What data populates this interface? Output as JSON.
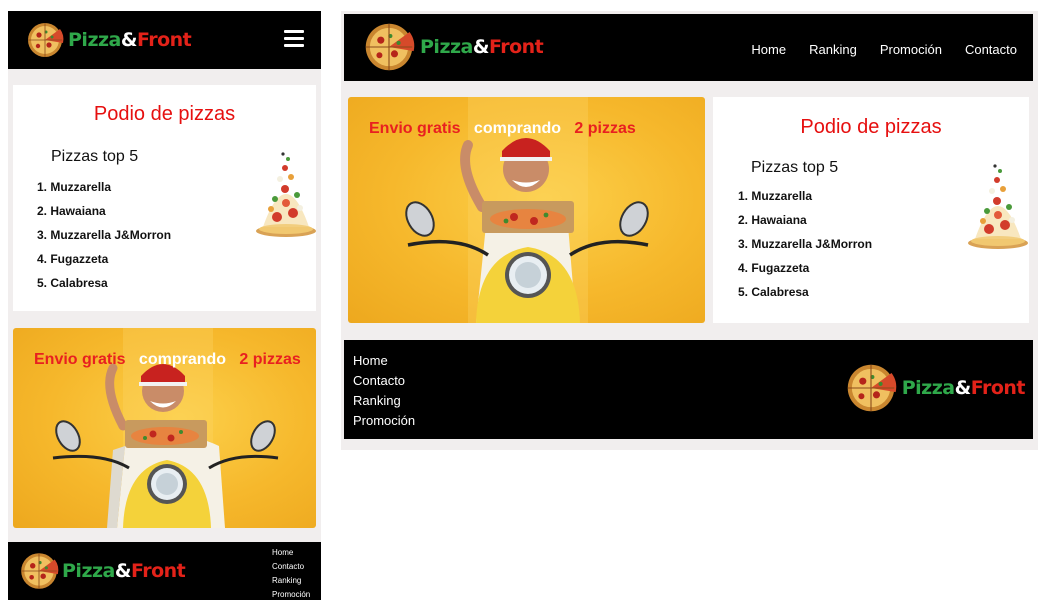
{
  "brand": {
    "part1": "Pizza",
    "amp": "&",
    "part2": "Front"
  },
  "nav": [
    "Home",
    "Ranking",
    "Promoción",
    "Contacto"
  ],
  "footer_links": [
    "Home",
    "Contacto",
    "Ranking",
    "Promoción"
  ],
  "podium": {
    "title": "Podio de pizzas",
    "subtitle": "Pizzas top 5",
    "items": [
      "Muzzarella",
      "Hawaiana",
      "Muzzarella J&Morron",
      "Fugazzeta",
      "Calabresa"
    ]
  },
  "promo": {
    "part1": "Envio gratis",
    "part2": "comprando",
    "part3": "2 pizzas"
  },
  "colors": {
    "header": "#000000",
    "green": "#2fa84a",
    "red": "#e32219",
    "promo_bg": "#f6b82c",
    "page_bg": "#f1eeee"
  },
  "icons": [
    "pizza-logo-icon",
    "hamburger-menu-icon",
    "pizza-tower-image",
    "delivery-man-scooter-image"
  ]
}
